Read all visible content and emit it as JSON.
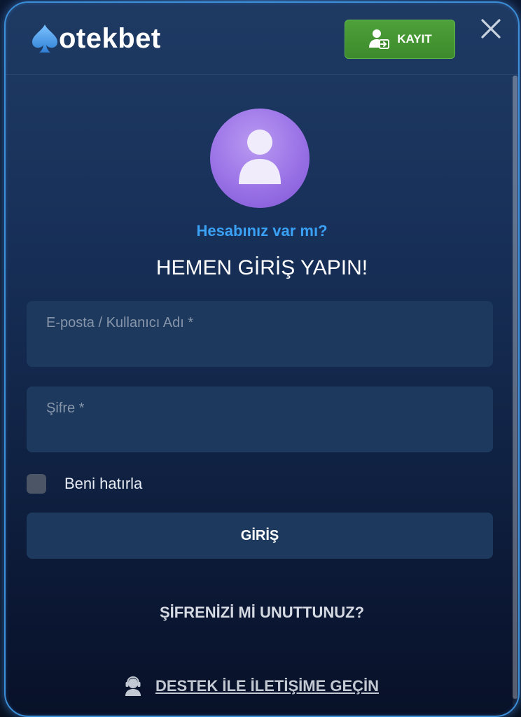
{
  "brand": {
    "logo_text": "otekbet"
  },
  "header": {
    "register_label": "KAYIT"
  },
  "login": {
    "question": "Hesabınız var mı?",
    "title": "HEMEN GİRİŞ YAPIN!",
    "username_label": "E-posta / Kullanıcı Adı *",
    "username_value": "",
    "password_label": "Şifre *",
    "password_value": "",
    "remember_label": "Beni hatırla",
    "remember_checked": false,
    "submit_label": "GİRİŞ",
    "forgot_label": "ŞİFRENİZİ Mİ UNUTTUNUZ?",
    "support_label": "DESTEK İLE İLETİŞİME GEÇİN"
  },
  "icons": {
    "logo": "spade-icon",
    "register": "user-login-icon",
    "close": "close-icon",
    "avatar": "user-icon",
    "support": "support-agent-icon"
  },
  "colors": {
    "accent_blue": "#3aa1f5",
    "register_green": "#4ea13b",
    "field_bg": "#1d3a5e",
    "avatar_purple": "#9a72e6",
    "modal_border": "#3b8ed8"
  }
}
